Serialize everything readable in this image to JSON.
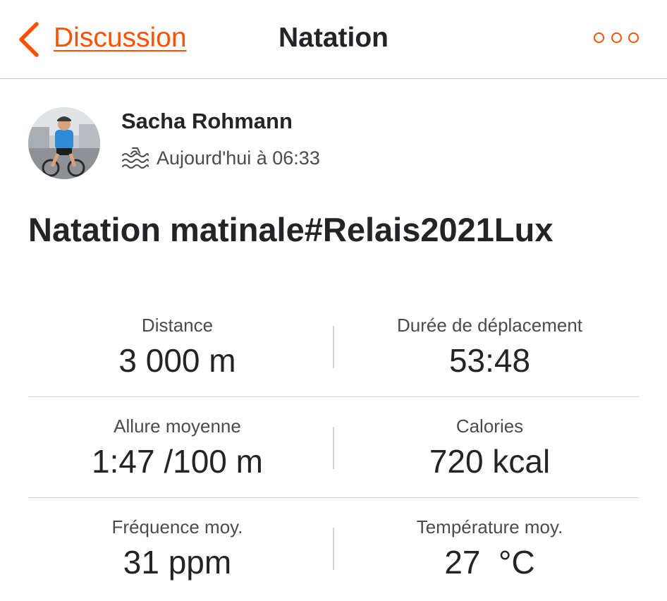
{
  "nav": {
    "back_label": "Discussion",
    "title": "Natation",
    "more_icon": "more-horizontal-icon",
    "back_icon": "chevron-left-icon"
  },
  "colors": {
    "accent": "#fc5200",
    "text_primary": "#242428",
    "text_secondary": "#4a4a50",
    "divider": "#d4d4d8"
  },
  "athlete": {
    "name": "Sacha Rohmann",
    "avatar_icon": "cyclist-avatar",
    "sport_icon": "swim-icon",
    "timestamp": "Aujourd'hui à 06:33"
  },
  "activity": {
    "title": "Natation matinale#Relais2021Lux"
  },
  "stats": [
    [
      {
        "label": "Distance",
        "value": "3 000 m"
      },
      {
        "label": "Durée de déplacement",
        "value": "53:48"
      }
    ],
    [
      {
        "label": "Allure moyenne",
        "value": "1:47 /100 m"
      },
      {
        "label": "Calories",
        "value": "720 kcal"
      }
    ],
    [
      {
        "label": "Fréquence moy.",
        "value": "31 ppm"
      },
      {
        "label": "Température moy.",
        "value": "27  °C"
      }
    ]
  ]
}
